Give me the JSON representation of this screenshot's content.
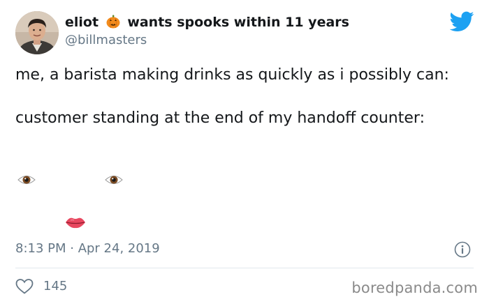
{
  "tweet": {
    "display_name": "eliot",
    "display_name_suffix": "wants spooks within 11 years",
    "handle": "@billmasters",
    "text_line1": "me, a barista making drinks as quickly as i possibly can:",
    "text_line2": "customer standing at the end of my handoff counter:",
    "timestamp": "8:13 PM · Apr 24, 2019",
    "like_count": "145"
  },
  "watermark": "boredpanda.com",
  "colors": {
    "twitter_blue": "#1da1f2",
    "secondary_text": "#657786",
    "divider": "#e1e8ed"
  },
  "icons": {
    "brand": "twitter-bird-icon",
    "name_emoji": "jack-o-lantern-icon",
    "info": "info-icon",
    "like": "heart-icon",
    "face_emojis": [
      "eye-icon",
      "eye-icon",
      "lips-icon"
    ]
  }
}
